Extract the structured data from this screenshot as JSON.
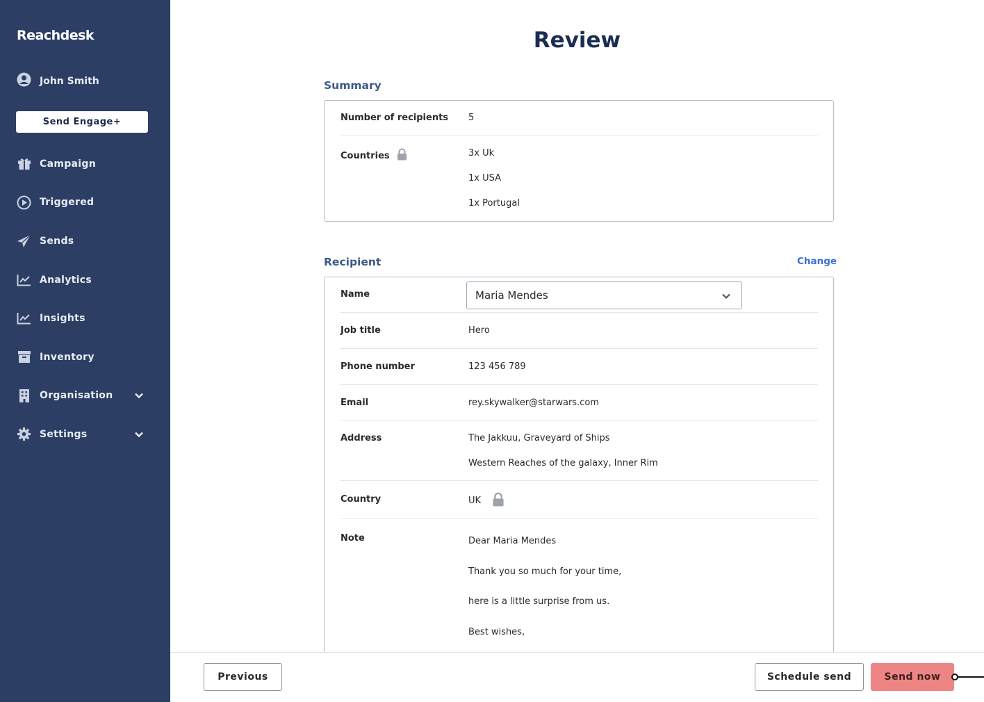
{
  "sidebar": {
    "brand": "Reachdesk",
    "user_name": "John Smith",
    "engage_button": "Send Engage+",
    "items": [
      {
        "label": "Campaign",
        "icon": "gift-icon"
      },
      {
        "label": "Triggered",
        "icon": "play-circle-icon"
      },
      {
        "label": "Sends",
        "icon": "paper-plane-icon"
      },
      {
        "label": "Analytics",
        "icon": "line-chart-icon"
      },
      {
        "label": "Insights",
        "icon": "line-chart-icon"
      },
      {
        "label": "Inventory",
        "icon": "archive-box-icon"
      },
      {
        "label": "Organisation",
        "icon": "building-icon",
        "expandable": true
      },
      {
        "label": "Settings",
        "icon": "gear-icon",
        "expandable": true
      }
    ]
  },
  "page": {
    "title": "Review"
  },
  "summary": {
    "heading": "Summary",
    "recipients_label": "Number of recipients",
    "recipients_value": "5",
    "countries_label": "Countries",
    "countries": [
      "3x Uk",
      "1x USA",
      "1x Portugal"
    ]
  },
  "recipient": {
    "heading": "Recipient",
    "change_link": "Change",
    "name_label": "Name",
    "name_value": "Maria Mendes",
    "job_label": "Job title",
    "job_value": "Hero",
    "phone_label": "Phone number",
    "phone_value": "123 456 789",
    "email_label": "Email",
    "email_value": "rey.skywalker@starwars.com",
    "address_label": "Address",
    "address_lines": [
      "The Jakkuu, Graveyard of Ships",
      "Western Reaches of the galaxy, Inner Rim"
    ],
    "country_label": "Country",
    "country_value": "UK",
    "note_label": "Note",
    "note_lines": [
      "Dear Maria Mendes",
      "Thank you so much for your time,",
      "here is a little surprise from us.",
      "Best wishes,"
    ]
  },
  "footer": {
    "previous": "Previous",
    "schedule": "Schedule send",
    "send_now": "Send now"
  },
  "colors": {
    "sidebar_bg": "#2c3e64",
    "primary_button": "#ee8585",
    "link": "#3b6fd4",
    "title": "#1b2d52"
  }
}
